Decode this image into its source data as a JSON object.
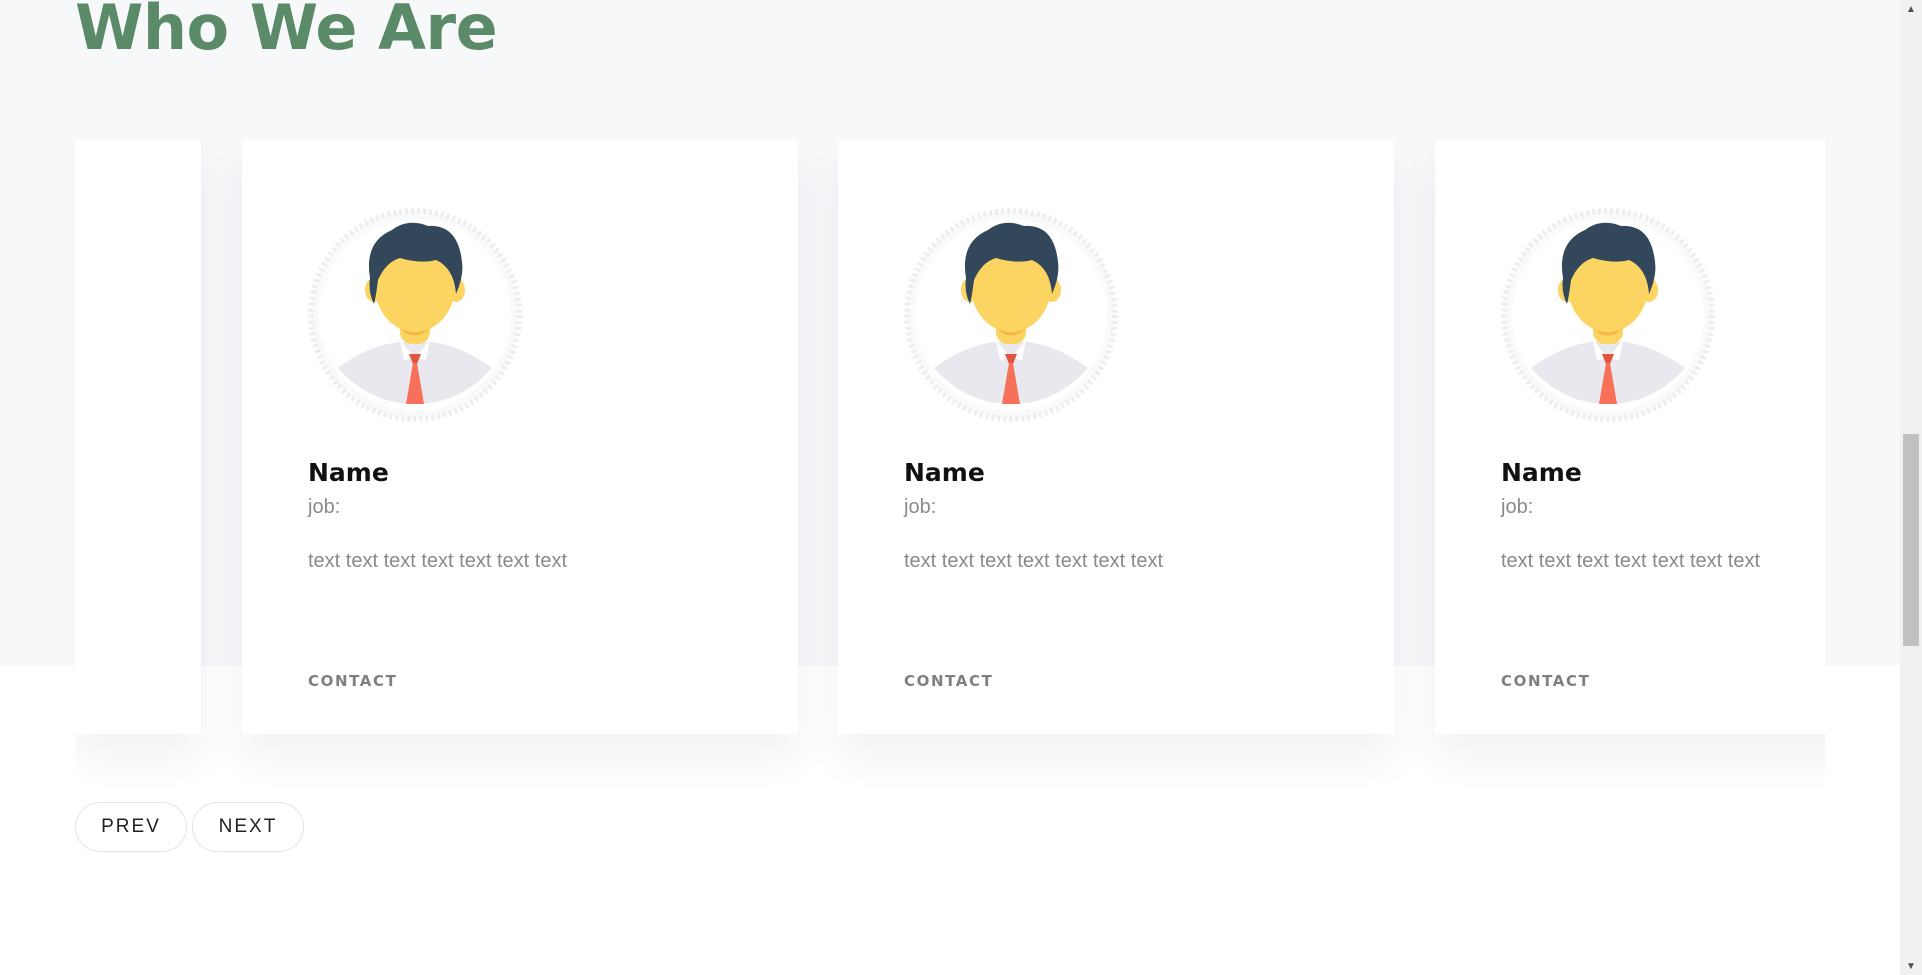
{
  "section": {
    "title": "Who We Are"
  },
  "team": [
    {
      "name": "Name",
      "job": "job:",
      "bio": "text text text text text text text",
      "contact_label": "CONTACT"
    },
    {
      "name": "Name",
      "job": "job:",
      "bio": "text text text text text text text",
      "contact_label": "CONTACT"
    },
    {
      "name": "Name",
      "job": "job:",
      "bio": "text text text text text text text",
      "contact_label": "CONTACT"
    }
  ],
  "carousel": {
    "prev_label": "PREV",
    "next_label": "NEXT"
  },
  "icons": {
    "avatar": "person-avatar-icon",
    "scroll_up": "scroll-up-arrow-icon",
    "scroll_down": "scroll-down-arrow-icon"
  },
  "colors": {
    "title": "#5b8a69",
    "band_background": "#f7f8fa",
    "avatar_hair": "#33475b",
    "avatar_skin": "#fcd462",
    "avatar_tie": "#f6705a",
    "avatar_shirt": "#e8e8ee"
  }
}
